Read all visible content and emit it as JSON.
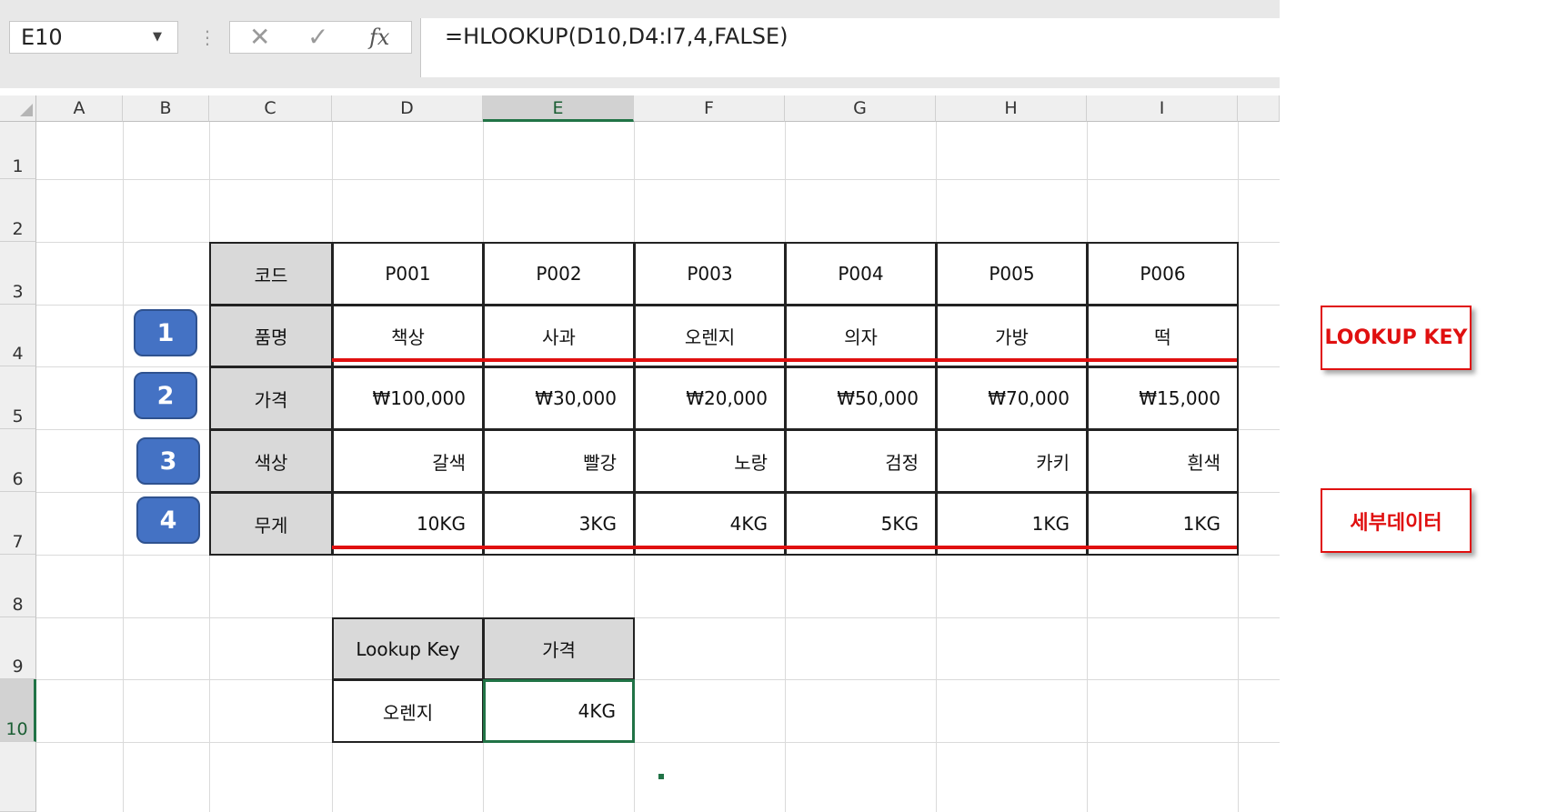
{
  "name_box": "E10",
  "formula": "=HLOOKUP(D10,D4:I7,4,FALSE)",
  "icons": {
    "cancel": "✕",
    "enter": "✓",
    "fx": "fx",
    "dropdown": "▼",
    "dots": "⋮"
  },
  "columns": [
    "A",
    "B",
    "C",
    "D",
    "E",
    "F",
    "G",
    "H",
    "I"
  ],
  "rows": [
    "1",
    "2",
    "3",
    "4",
    "5",
    "6",
    "7",
    "8",
    "9",
    "10"
  ],
  "table": {
    "headers": [
      "코드",
      "품명",
      "가격",
      "색상",
      "무게"
    ],
    "codes": [
      "P001",
      "P002",
      "P003",
      "P004",
      "P005",
      "P006"
    ],
    "names": [
      "책상",
      "사과",
      "오렌지",
      "의자",
      "가방",
      "떡"
    ],
    "prices": [
      "₩100,000",
      "₩30,000",
      "₩20,000",
      "₩50,000",
      "₩70,000",
      "₩15,000"
    ],
    "colors": [
      "갈색",
      "빨강",
      "노랑",
      "검정",
      "카키",
      "흰색"
    ],
    "weights": [
      "10KG",
      "3KG",
      "4KG",
      "5KG",
      "1KG",
      "1KG"
    ]
  },
  "badges": [
    "1",
    "2",
    "3",
    "4"
  ],
  "lookup": {
    "key_header": "Lookup Key",
    "value_header": "가격",
    "key": "오렌지",
    "result": "4KG"
  },
  "callouts": {
    "lookup_key": "LOOKUP KEY",
    "detail": "세부데이터"
  },
  "colors": {
    "accent_green": "#217346",
    "badge_blue": "#4472c4",
    "highlight_red": "#e01010",
    "header_fill": "#d9d9d9"
  }
}
